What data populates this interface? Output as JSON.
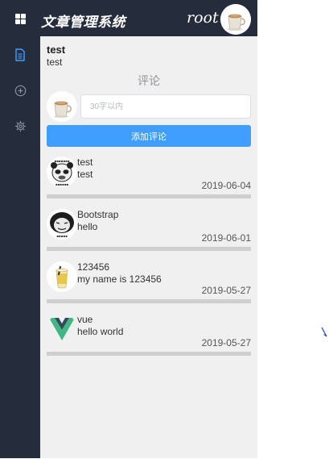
{
  "header": {
    "app_title": "文章管理系统",
    "username": "root"
  },
  "sidebar": {
    "items": [
      {
        "name": "articles",
        "icon": "document-icon",
        "active": true
      },
      {
        "name": "add",
        "icon": "plus-circle-icon",
        "active": false
      },
      {
        "name": "settings",
        "icon": "gear-icon",
        "active": false
      }
    ]
  },
  "article": {
    "title": "test",
    "body": "test"
  },
  "comments_section": {
    "heading": "评论",
    "input_placeholder": "30字以内",
    "input_value": "",
    "add_button_label": "添加评论"
  },
  "comments": [
    {
      "user": "test",
      "text": "test",
      "date": "2019-06-04",
      "avatar": "meme-panda-avatar"
    },
    {
      "user": "Bootstrap",
      "text": "hello",
      "date": "2019-06-01",
      "avatar": "meme-face-avatar"
    },
    {
      "user": "123456",
      "text": "my name is 123456",
      "date": "2019-05-27",
      "avatar": "drink-avatar"
    },
    {
      "user": "vue",
      "text": "hello world",
      "date": "2019-05-27",
      "avatar": "vue-logo-avatar"
    }
  ],
  "colors": {
    "nav_bg": "#252d3d",
    "content_bg": "#f0f0f0",
    "primary": "#409eff",
    "sidebar_active": "#409eff",
    "sidebar_icon": "#8a919e"
  }
}
